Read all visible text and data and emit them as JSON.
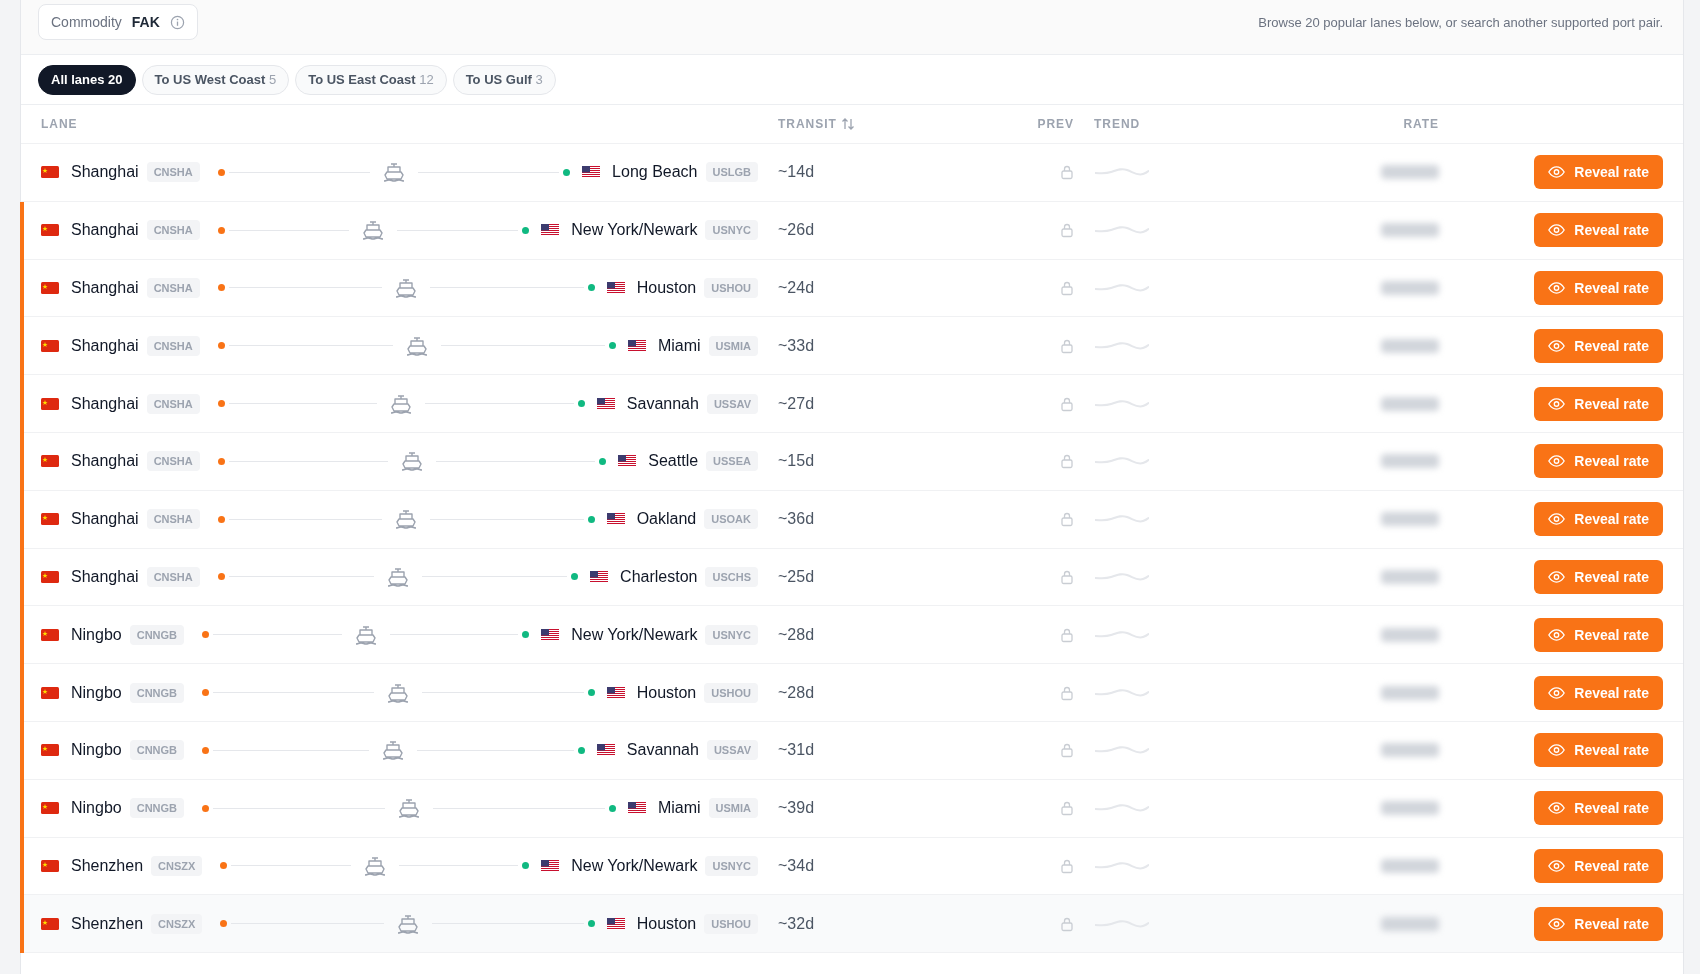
{
  "commodity": {
    "label": "Commodity",
    "value": "FAK"
  },
  "intro": "Browse 20 popular lanes below, or search another supported port pair.",
  "filters": [
    {
      "label": "All lanes",
      "count": "20",
      "selected": true
    },
    {
      "label": "To US West Coast",
      "count": "5",
      "selected": false
    },
    {
      "label": "To US East Coast",
      "count": "12",
      "selected": false
    },
    {
      "label": "To US Gulf",
      "count": "3",
      "selected": false
    }
  ],
  "columns": {
    "lane": "LANE",
    "transit": "TRANSIT",
    "prev": "PREV",
    "trend": "TREND",
    "rate": "RATE"
  },
  "rows": [
    {
      "origin": {
        "city": "Shanghai",
        "code": "CNSHA",
        "kind": "cn"
      },
      "destination": {
        "city": "Long Beach",
        "code": "USLGB",
        "kind": "us"
      },
      "transit": "~14d",
      "accent": false,
      "hovered": false,
      "action": "Reveal rate"
    },
    {
      "origin": {
        "city": "Shanghai",
        "code": "CNSHA",
        "kind": "cn"
      },
      "destination": {
        "city": "New York/Newark",
        "code": "USNYC",
        "kind": "us"
      },
      "transit": "~26d",
      "accent": true,
      "hovered": false,
      "action": "Reveal rate"
    },
    {
      "origin": {
        "city": "Shanghai",
        "code": "CNSHA",
        "kind": "cn"
      },
      "destination": {
        "city": "Houston",
        "code": "USHOU",
        "kind": "us"
      },
      "transit": "~24d",
      "accent": true,
      "hovered": false,
      "action": "Reveal rate"
    },
    {
      "origin": {
        "city": "Shanghai",
        "code": "CNSHA",
        "kind": "cn"
      },
      "destination": {
        "city": "Miami",
        "code": "USMIA",
        "kind": "us"
      },
      "transit": "~33d",
      "accent": true,
      "hovered": false,
      "action": "Reveal rate"
    },
    {
      "origin": {
        "city": "Shanghai",
        "code": "CNSHA",
        "kind": "cn"
      },
      "destination": {
        "city": "Savannah",
        "code": "USSAV",
        "kind": "us"
      },
      "transit": "~27d",
      "accent": true,
      "hovered": false,
      "action": "Reveal rate"
    },
    {
      "origin": {
        "city": "Shanghai",
        "code": "CNSHA",
        "kind": "cn"
      },
      "destination": {
        "city": "Seattle",
        "code": "USSEA",
        "kind": "us"
      },
      "transit": "~15d",
      "accent": true,
      "hovered": false,
      "action": "Reveal rate"
    },
    {
      "origin": {
        "city": "Shanghai",
        "code": "CNSHA",
        "kind": "cn"
      },
      "destination": {
        "city": "Oakland",
        "code": "USOAK",
        "kind": "us"
      },
      "transit": "~36d",
      "accent": true,
      "hovered": false,
      "action": "Reveal rate"
    },
    {
      "origin": {
        "city": "Shanghai",
        "code": "CNSHA",
        "kind": "cn"
      },
      "destination": {
        "city": "Charleston",
        "code": "USCHS",
        "kind": "us"
      },
      "transit": "~25d",
      "accent": true,
      "hovered": false,
      "action": "Reveal rate"
    },
    {
      "origin": {
        "city": "Ningbo",
        "code": "CNNGB",
        "kind": "cn"
      },
      "destination": {
        "city": "New York/Newark",
        "code": "USNYC",
        "kind": "us"
      },
      "transit": "~28d",
      "accent": true,
      "hovered": false,
      "action": "Reveal rate"
    },
    {
      "origin": {
        "city": "Ningbo",
        "code": "CNNGB",
        "kind": "cn"
      },
      "destination": {
        "city": "Houston",
        "code": "USHOU",
        "kind": "us"
      },
      "transit": "~28d",
      "accent": true,
      "hovered": false,
      "action": "Reveal rate"
    },
    {
      "origin": {
        "city": "Ningbo",
        "code": "CNNGB",
        "kind": "cn"
      },
      "destination": {
        "city": "Savannah",
        "code": "USSAV",
        "kind": "us"
      },
      "transit": "~31d",
      "accent": true,
      "hovered": false,
      "action": "Reveal rate"
    },
    {
      "origin": {
        "city": "Ningbo",
        "code": "CNNGB",
        "kind": "cn"
      },
      "destination": {
        "city": "Miami",
        "code": "USMIA",
        "kind": "us"
      },
      "transit": "~39d",
      "accent": true,
      "hovered": false,
      "action": "Reveal rate"
    },
    {
      "origin": {
        "city": "Shenzhen",
        "code": "CNSZX",
        "kind": "cn"
      },
      "destination": {
        "city": "New York/Newark",
        "code": "USNYC",
        "kind": "us"
      },
      "transit": "~34d",
      "accent": true,
      "hovered": false,
      "action": "Reveal rate"
    },
    {
      "origin": {
        "city": "Shenzhen",
        "code": "CNSZX",
        "kind": "cn"
      },
      "destination": {
        "city": "Houston",
        "code": "USHOU",
        "kind": "us"
      },
      "transit": "~32d",
      "accent": true,
      "hovered": true,
      "action": "Reveal rate"
    }
  ]
}
